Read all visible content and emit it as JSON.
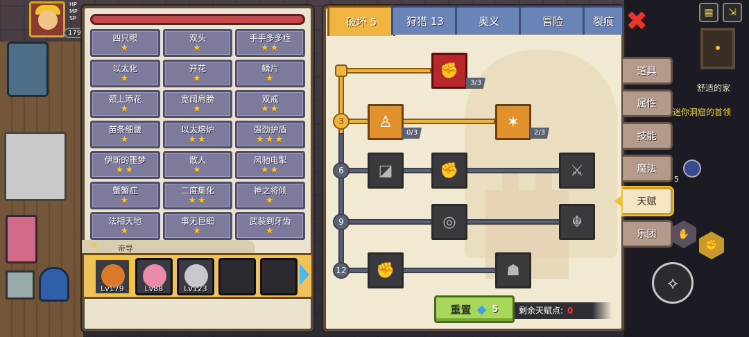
{
  "hud": {
    "level": "179",
    "bar_labels": [
      "HP",
      "MP",
      "SP"
    ],
    "location": "舒适的家",
    "quest": "迷你洞窟的首领",
    "side_number": "5"
  },
  "traits": [
    {
      "name": "四只眼",
      "stars": "★"
    },
    {
      "name": "双头",
      "stars": "★"
    },
    {
      "name": "手手多多症",
      "stars": "★★"
    },
    {
      "name": "以太化",
      "stars": "★"
    },
    {
      "name": "开花",
      "stars": "★"
    },
    {
      "name": "鳞片",
      "stars": "★"
    },
    {
      "name": "颈上添花",
      "stars": "★"
    },
    {
      "name": "宽阔肩膀",
      "stars": "★"
    },
    {
      "name": "双戒",
      "stars": "★★"
    },
    {
      "name": "苗条细腰",
      "stars": "★"
    },
    {
      "name": "以太熔炉",
      "stars": "★★"
    },
    {
      "name": "强劲护盾",
      "stars": "★★★"
    },
    {
      "name": "伊斯的噩梦",
      "stars": "★★"
    },
    {
      "name": "散人",
      "stars": "★"
    },
    {
      "name": "风驰电掣",
      "stars": "★★"
    },
    {
      "name": "蟹蟹症",
      "stars": "★"
    },
    {
      "name": "二度集化",
      "stars": "★★"
    },
    {
      "name": "神之将倾",
      "stars": "★"
    },
    {
      "name": "法相天地",
      "stars": "★"
    },
    {
      "name": "事无巨细",
      "stars": "★"
    },
    {
      "name": "武装到牙齿",
      "stars": "★"
    }
  ],
  "team": {
    "header_icon": "✕",
    "header_label": "帝导",
    "heroes": [
      {
        "lv": "Lv179",
        "color": "#d97a2a"
      },
      {
        "lv": "Lv88",
        "color": "#e88aa8"
      },
      {
        "lv": "Lv123",
        "color": "#c8c8cc"
      },
      {
        "lv": "",
        "color": ""
      },
      {
        "lv": "",
        "color": ""
      }
    ]
  },
  "tabs": [
    {
      "label": "破坏 5",
      "active": true
    },
    {
      "label": "狩猎 13",
      "active": false
    },
    {
      "label": "奥义",
      "active": false
    },
    {
      "label": "冒险",
      "active": false
    },
    {
      "label": "裂痕",
      "active": false
    }
  ],
  "side_tabs": [
    {
      "label": "道具",
      "active": false
    },
    {
      "label": "属性",
      "active": false
    },
    {
      "label": "技能",
      "active": false
    },
    {
      "label": "魔法",
      "active": false
    },
    {
      "label": "天赋",
      "active": true
    },
    {
      "label": "乐团",
      "active": false
    }
  ],
  "tree": {
    "tiers": [
      "3",
      "6",
      "9",
      "12"
    ],
    "counts": {
      "arm_wrestle": "3/3",
      "body": "0/3",
      "claw": "2/3"
    }
  },
  "footer": {
    "reset_label": "重置",
    "reset_cost": "5",
    "remaining_label": "剩余天赋点:",
    "remaining_value": "0"
  },
  "colors": {
    "active_tab": "#f0b540",
    "inactive_tab": "#6b84b7",
    "trait_cell": "#7d7b9c",
    "star": "#f7c531",
    "reset_button": "#a8d85a"
  }
}
